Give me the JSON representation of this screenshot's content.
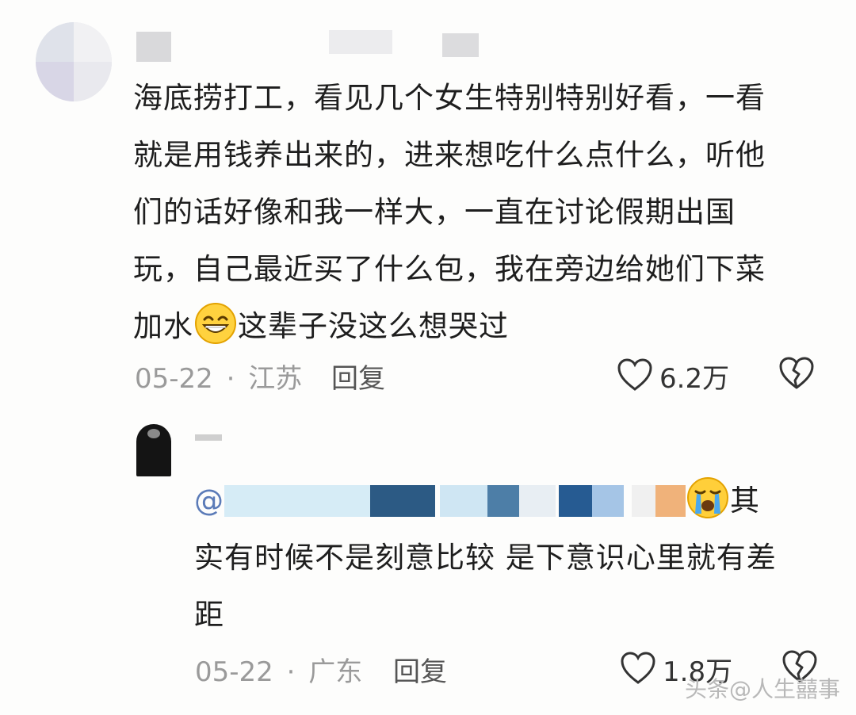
{
  "comment": {
    "text_lines": [
      "海底捞打工，看见几个女生特别特别好看，一看",
      "就是用钱养出来的，进来想吃什么点什么，听他",
      "们的话好像和我一样大，一直在讨论假期出国",
      "玩，自己最近买了什么包，我在旁边给她们下菜"
    ],
    "last_line_before_emoji": "加水",
    "last_line_after_emoji": "这辈子没这么想哭过",
    "emoji_icon": "grin-sweat-emoji",
    "date": "05-22",
    "separator": "·",
    "location": "江苏",
    "reply_label": "回复",
    "like_count": "6.2万"
  },
  "reply": {
    "mention_prefix": "@",
    "emoji_icon": "crying-emoji",
    "first_line_tail": "其",
    "text_lines": [
      "实有时候不是刻意比较 是下意识心里就有差",
      "距"
    ],
    "date": "05-22",
    "separator": "·",
    "location": "广东",
    "reply_label": "回复",
    "like_count": "1.8万"
  },
  "watermark": {
    "text": "头条@人生囍事"
  }
}
